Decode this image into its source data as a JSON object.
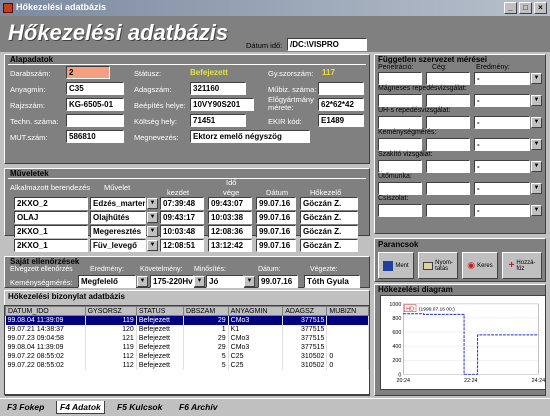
{
  "window": {
    "title": "Hőkezelési adatbázis",
    "min": "_",
    "max": "□",
    "close": "×"
  },
  "header": {
    "app_title": "Hőkezelési adatbázis",
    "datum_label": "Dátum idő:",
    "datum_value": "/DC:\\VISPRO"
  },
  "alap": {
    "title": "Alapadatok",
    "darabszam_label": "Darabszám:",
    "darabszam": "2",
    "anyagmin_label": "Anyagmin:",
    "anyagmin": "C35",
    "rajzszam_label": "Rajzszám:",
    "rajzszam": "KG-6505-01",
    "techn_label": "Techn. száma:",
    "techn": "",
    "mut_label": "MUT.szám:",
    "mut": "586810",
    "statusz_label": "Státusz:",
    "statusz": "Befejezett",
    "adagszam_label": "Adagszám:",
    "adagszam": "321160",
    "beepites_label": "Beépítés helye:",
    "beepites": "10VY90S201",
    "koltseg_label": "Költség hely:",
    "koltseg": "71451",
    "megnevezes_label": "Megnevezés:",
    "megnevezes": "Ektorz emelő négyszög",
    "gyszorszam_label": "Gy.szorszám:",
    "gyszorszam": "117",
    "mubiz_label": "Műbiz. száma:",
    "mubiz": "",
    "eloigazitas_label": "Előgyártmány mérete:",
    "eloigazitas": "62*62*42",
    "ekir_label": "EKIR kód:",
    "ekir": "E1489"
  },
  "muveletek": {
    "title": "Műveletek",
    "col_alk": "Alkalmazott berendezés",
    "col_muv": "Művelet",
    "col_ido": "Idő",
    "col_kezdet": "kezdet",
    "col_vege": "vége",
    "col_datum": "Dátum",
    "col_hok": "Hőkezelő",
    "rows": [
      {
        "ber": "2KXO_2",
        "muv": "Edzés_marter",
        "kezdet": "07:39:48",
        "vege": "09:43:07",
        "datum": "99.07.16",
        "hok": "Göczán Z."
      },
      {
        "ber": "OLAJ",
        "muv": "Olajhűtés",
        "kezdet": "09:43:17",
        "vege": "10:03:38",
        "datum": "99.07.16",
        "hok": "Göczán Z."
      },
      {
        "ber": "2KXO_1",
        "muv": "Megeresztés",
        "kezdet": "10:03:48",
        "vege": "12:08:36",
        "datum": "99.07.16",
        "hok": "Göczán Z."
      },
      {
        "ber": "2KXO_1",
        "muv": "Füv_levegő",
        "kezdet": "12:08:51",
        "vege": "13:12:42",
        "datum": "99.07.16",
        "hok": "Göczán Z."
      }
    ]
  },
  "sajat": {
    "title": "Saját ellenőrzések",
    "elv_label": "Elvégzett ellenőrzés",
    "ered_label": "Eredmény:",
    "kov_label": "Követelmény:",
    "min_label": "Minősítés:",
    "datum_label": "Dátum:",
    "vegezte_label": "Végezte:",
    "kemeny_label": "Keménységmérés:",
    "ered": "Megfelelő",
    "kov": "175-220Hv",
    "min": "Jó",
    "datum": "99.07.16",
    "vegezte": "Tóth Gyula"
  },
  "fuggetlen": {
    "title": "Független szervezet mérései",
    "pen_label": "Penetráció:",
    "ceg_label": "Cég:",
    "ered_label": "Eredmény:",
    "mag_label": "Mágneses repedésvizsgálat:",
    "uh_label": "UH-s repedésvizsgálat:",
    "kem_label": "Keménységmérés:",
    "szak_label": "Szakító vizsgálat:",
    "uto_label": "Ütőmunka:",
    "csisz_label": "Csiszolat:",
    "dash": "-"
  },
  "parancsok": {
    "title": "Parancsok",
    "ment": "Ment",
    "nyomtat": "Nyom-\ntatás",
    "keres": "Keres",
    "hozzafuz": "Hozzá-\nfűz"
  },
  "db": {
    "title": "Hőkezelési bizonylat adatbázis",
    "cols": [
      "DATUM_IDO",
      "GYSORSZ",
      "STATUS",
      "DBSZAM",
      "ANYAGMIN",
      "ADAGSZ",
      "MUBIZN"
    ],
    "rows": [
      [
        "99.08.04 11:39:09",
        "119",
        "Befejezett",
        "29",
        "CMo3",
        "377515",
        ""
      ],
      [
        "99.07.21 14:38:37",
        "120",
        "Befejezett",
        "1",
        "K1",
        "377515",
        ""
      ],
      [
        "99.07.23 09:04:58",
        "121",
        "Befejezett",
        "29",
        "CMo3",
        "377515",
        ""
      ],
      [
        "99.08.04 11:39:09",
        "119",
        "Befejezett",
        "29",
        "CMo3",
        "377515",
        ""
      ],
      [
        "99.07.22 08:55:02",
        "112",
        "Befejezett",
        "5",
        "C25",
        "310502",
        "0"
      ],
      [
        "99.07.22 08:55:02",
        "112",
        "Befejezett",
        "5",
        "C25",
        "310502",
        "0"
      ]
    ]
  },
  "diagram": {
    "title": "Hőkezelési diagram",
    "legend": "HD",
    "annot": "(1999.07.16 00:)",
    "yticks": [
      "1000",
      "800",
      "600",
      "400",
      "200",
      "0"
    ],
    "xticks": [
      "20:24",
      "22:24",
      "24:24"
    ]
  },
  "chart_data": {
    "type": "line",
    "title": "Hőkezelési diagram",
    "xlabel": "",
    "ylabel": "",
    "ylim": [
      0,
      1000
    ],
    "x_ticks": [
      "20:24",
      "22:24",
      "24:24"
    ],
    "series": [
      {
        "name": "HD",
        "points": [
          [
            0,
            860
          ],
          [
            0.15,
            860
          ],
          [
            0.15,
            850
          ],
          [
            0.45,
            850
          ],
          [
            0.45,
            0
          ],
          [
            0.55,
            0
          ],
          [
            0.55,
            560
          ],
          [
            1,
            560
          ]
        ]
      }
    ]
  },
  "tabs": [
    "F3 Fokep",
    "F4 Adatok",
    "F5 Kulcsok",
    "F6 Archív"
  ]
}
